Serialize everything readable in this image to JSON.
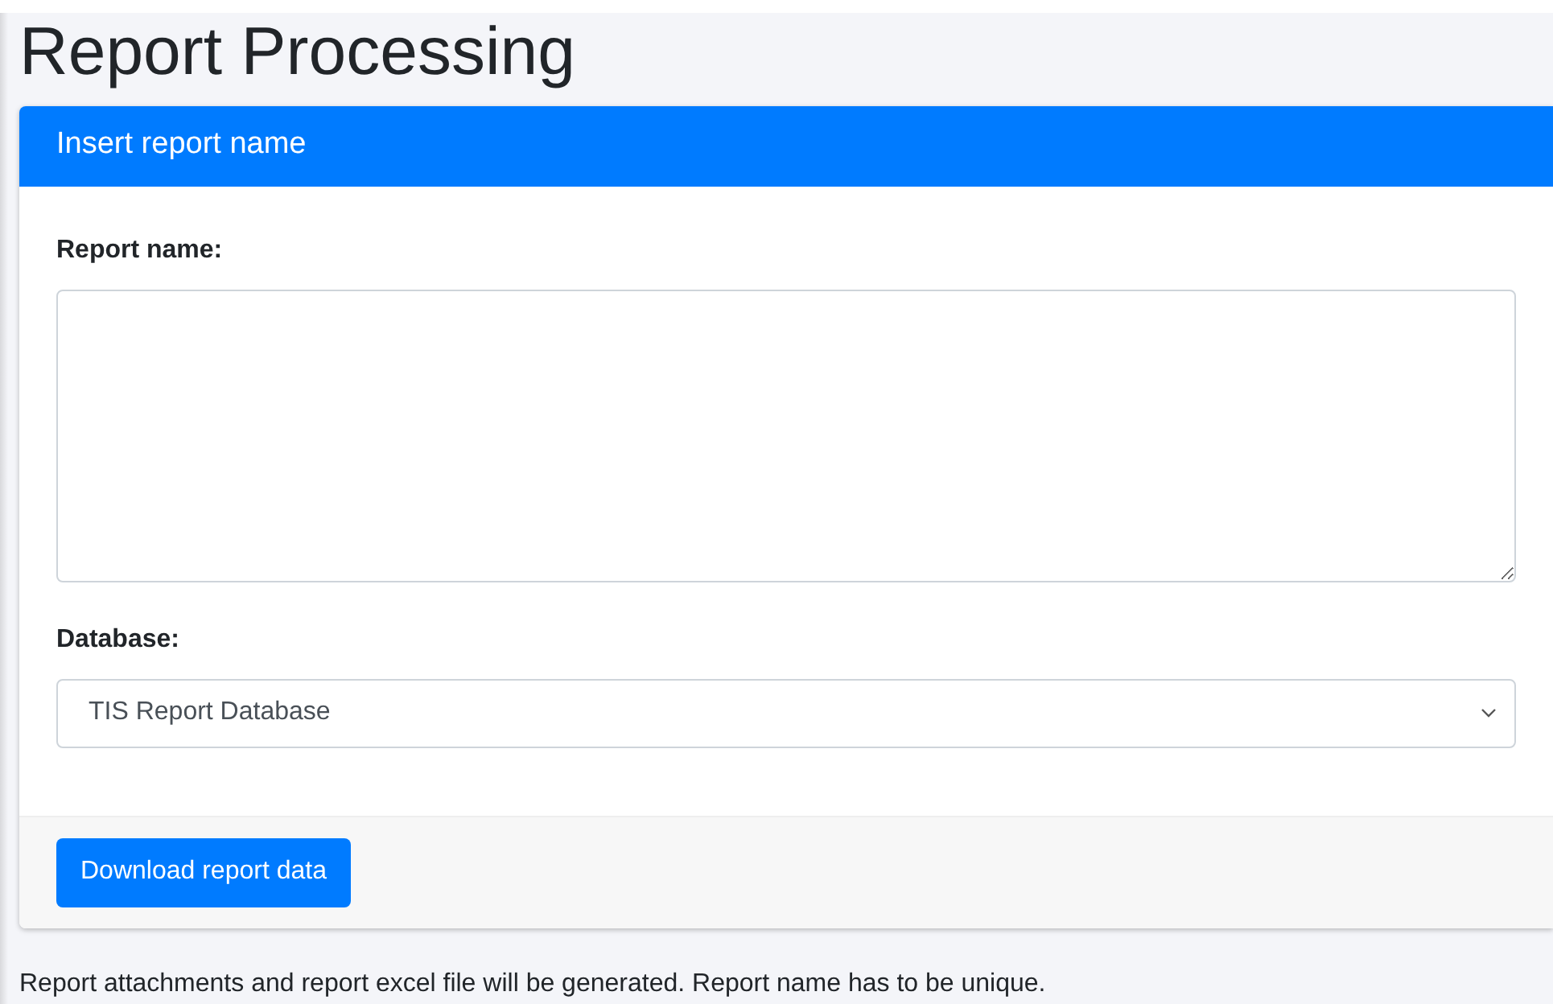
{
  "page": {
    "title": "Report Processing"
  },
  "card": {
    "header": "Insert report name",
    "report_name": {
      "label": "Report name:"
    },
    "database": {
      "label": "Database:",
      "value": "TIS Report Database"
    },
    "button": "Download report data"
  },
  "note": "Report attachments and report excel file will be generated. Report name has to be unique."
}
